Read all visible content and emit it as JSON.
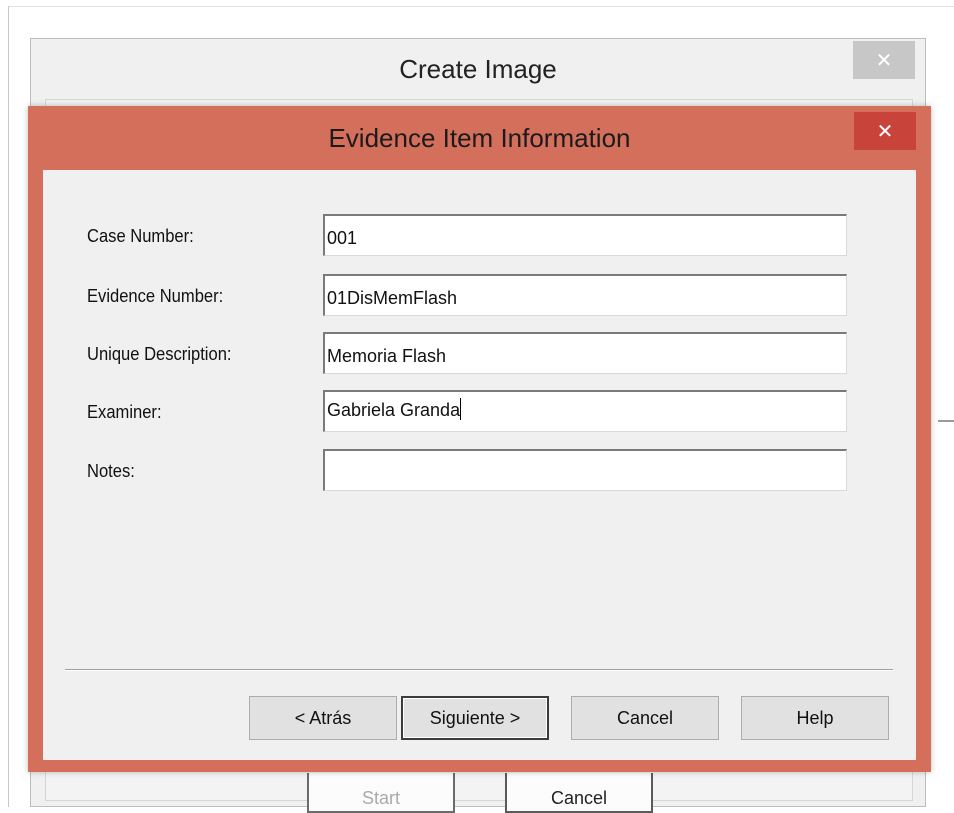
{
  "background_window": {
    "title": "Create Image",
    "close_glyph": "✕",
    "buttons": {
      "start_label": "Start",
      "cancel_label": "Cancel"
    }
  },
  "dialog": {
    "title": "Evidence Item Information",
    "close_glyph": "✕",
    "fields": {
      "case_number": {
        "label": "Case Number:",
        "value": "001"
      },
      "evidence_number": {
        "label": "Evidence Number:",
        "value": "01DisMemFlash"
      },
      "unique_description": {
        "label": "Unique Description:",
        "value": "Memoria Flash"
      },
      "examiner": {
        "label": "Examiner:",
        "value": "Gabriela Granda"
      },
      "notes": {
        "label": "Notes:",
        "value": ""
      }
    },
    "buttons": {
      "back_label": "< Atrás",
      "next_label": "Siguiente >",
      "cancel_label": "Cancel",
      "help_label": "Help"
    }
  },
  "colors": {
    "dialog_frame": "#d46f5c",
    "dialog_close": "#c8433a",
    "window_background": "#f0f0f0"
  }
}
